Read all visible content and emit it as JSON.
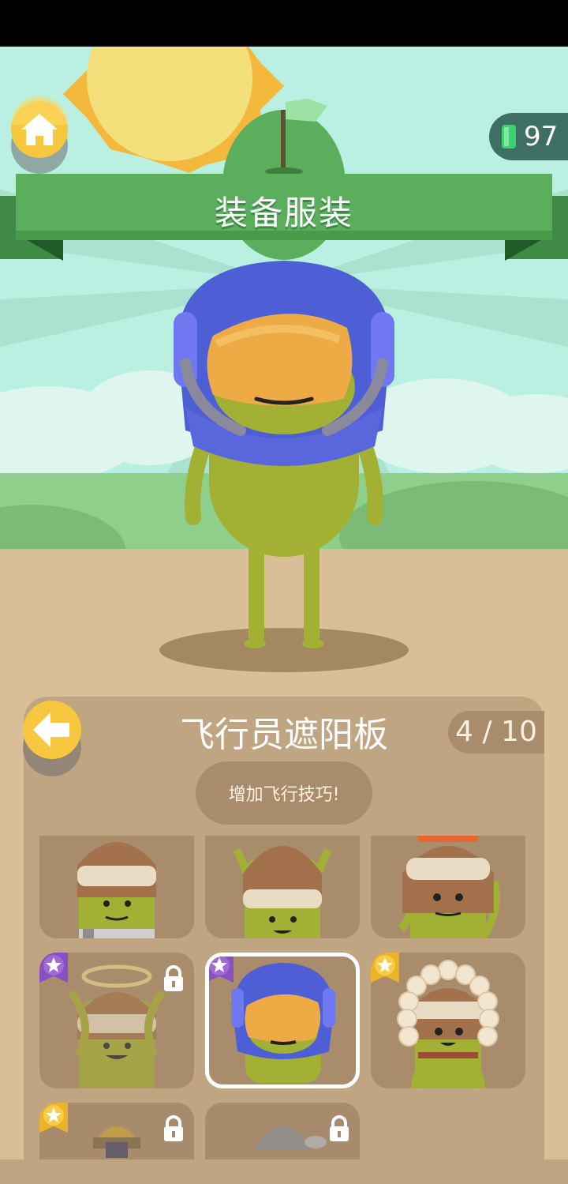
{
  "header": {
    "title": "装备服装",
    "gems": "97"
  },
  "colors": {
    "sky": "#b9f0e1",
    "banner_green": "#5aae5c",
    "ground": "#d8bf98",
    "panel": "#c0a583",
    "tile": "#a88c6c",
    "button_yellow": "#f7c73f",
    "character_green": "#a2b033",
    "visor_blue": "#4e5fd6",
    "visor_orange": "#eeaa44"
  },
  "item": {
    "name": "飞行员遮阳板",
    "page": "4 / 10",
    "description": "增加飞行技巧!"
  },
  "icons": {
    "home": "home-icon",
    "back": "arrow-left-icon",
    "gem": "gem-icon",
    "lock": "lock-icon",
    "star_badge": "star-badge-icon"
  },
  "grid": {
    "items": [
      {
        "slot": 1,
        "type": "scarf-hat",
        "locked": false,
        "badge": "none"
      },
      {
        "slot": 2,
        "type": "brown-hat",
        "locked": false,
        "badge": "none"
      },
      {
        "slot": 3,
        "type": "ushanka-hat",
        "locked": false,
        "badge": "none"
      },
      {
        "slot": 4,
        "type": "halo",
        "locked": true,
        "badge": "purple-star"
      },
      {
        "slot": 5,
        "type": "pilot-visor",
        "locked": false,
        "badge": "purple-star",
        "selected": true
      },
      {
        "slot": 6,
        "type": "eskimo-hood",
        "locked": false,
        "badge": "gold-star"
      },
      {
        "slot": 7,
        "type": "hardhat",
        "locked": true,
        "badge": "gold-star"
      },
      {
        "slot": 8,
        "type": "grey-beanie",
        "locked": true,
        "badge": "none"
      }
    ]
  }
}
